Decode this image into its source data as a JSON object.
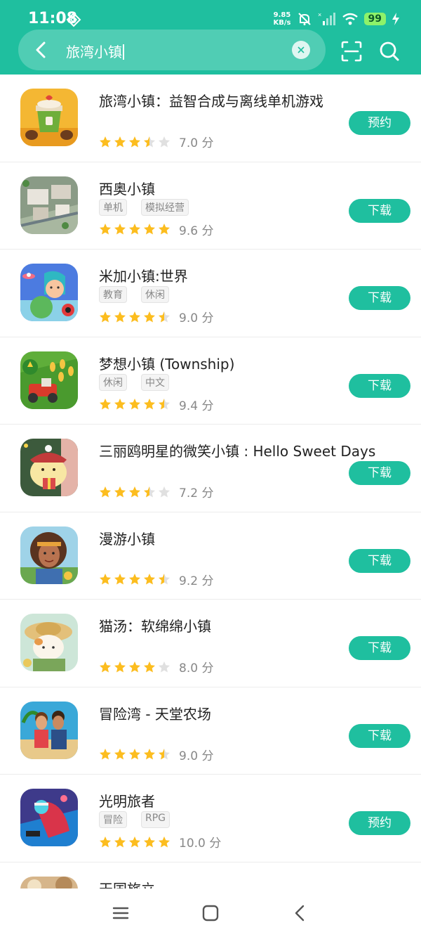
{
  "status": {
    "time": "11:08",
    "net_speed_value": "9.85",
    "net_speed_unit": "KB/s",
    "battery": "99"
  },
  "search": {
    "query": "旅湾小镇"
  },
  "colors": {
    "accent": "#1fbf9f",
    "star": "#fcbd1f",
    "star_empty": "#e0e0e0"
  },
  "results": [
    {
      "title": "旅湾小镇：益智合成与离线单机游戏",
      "tags": [],
      "rating": 3.5,
      "score": "7.0 分",
      "button": "预约",
      "icon": "coffee-cup-app-icon"
    },
    {
      "title": "西奥小镇",
      "tags": [
        "单机",
        "模拟经营"
      ],
      "rating": 5,
      "score": "9.6 分",
      "button": "下载",
      "icon": "city-aerial-app-icon"
    },
    {
      "title": "米加小镇:世界",
      "tags": [
        "教育",
        "休闲"
      ],
      "rating": 4.5,
      "score": "9.0 分",
      "button": "下载",
      "icon": "toca-girl-app-icon"
    },
    {
      "title": "梦想小镇 (Township)",
      "tags": [
        "休闲",
        "中文"
      ],
      "rating": 4.5,
      "score": "9.4 分",
      "button": "下载",
      "icon": "tractor-farm-app-icon"
    },
    {
      "title": "三丽鸥明星的微笑小镇 : Hello Sweet Days",
      "tags": [],
      "rating": 3.5,
      "score": "7.2 分",
      "button": "下载",
      "icon": "pompompurin-app-icon"
    },
    {
      "title": "漫游小镇",
      "tags": [],
      "rating": 4.5,
      "score": "9.2 分",
      "button": "下载",
      "icon": "girl-portrait-app-icon"
    },
    {
      "title": "猫汤：软绵绵小镇",
      "tags": [],
      "rating": 4,
      "score": "8.0 分",
      "button": "下载",
      "icon": "cat-farmer-app-icon"
    },
    {
      "title": "冒险湾 - 天堂农场",
      "tags": [],
      "rating": 4.5,
      "score": "9.0 分",
      "button": "下载",
      "icon": "island-couple-app-icon"
    },
    {
      "title": "光明旅者",
      "tags": [
        "冒险",
        "RPG"
      ],
      "rating": 5,
      "score": "10.0 分",
      "button": "预约",
      "icon": "hero-cape-app-icon"
    },
    {
      "title": "天国旅立",
      "tags": [],
      "rating": 0,
      "score": "",
      "button": "",
      "icon": "partial-app-icon"
    }
  ]
}
